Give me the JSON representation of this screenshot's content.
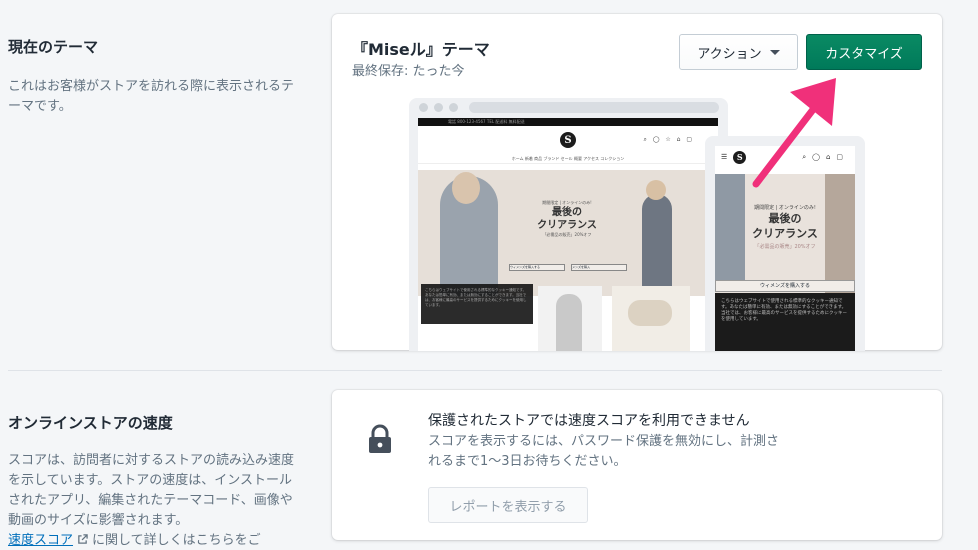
{
  "current_theme": {
    "heading": "現在のテーマ",
    "description": "これはお客様がストアを訪れる際に表示されるテーマです。",
    "theme_name": "『Miseル』テーマ",
    "saved_label": "最終保存: たった今",
    "action_button": "アクション",
    "customize_button": "カスタマイズ",
    "accent_color": "#007a5a",
    "arrow_color": "#f0307a"
  },
  "preview": {
    "topbar_text": "電話 800-123-4567 TEL   配送料 無料配送",
    "logo_letter": "S",
    "nav_text": "ホーム 新着  商品  ブランド  セール  概要  アクセス  コレクション",
    "hero_small": "期間限定 | オンラインのみ!",
    "hero_line1": "最後の",
    "hero_line2": "クリアランス",
    "hero_sub": "「必需品の販売」20%オフ",
    "hero_btn_women": "ウィメンズを購入する",
    "hero_btn_men": "メンズを購入",
    "cookie_text": "こちらはウェブサイトで使用される標準的なクッキー通知です。あなたは簡単に有効、または無効にすることができます。当社では、お客様に最高のサービスを提供するためにクッキーを使用しています。",
    "mobile_hero_small": "期間限定 | オンラインのみ!",
    "mobile_hero_line1": "最後の",
    "mobile_hero_line2": "クリアランス",
    "mobile_hero_sub": "「必需品の販売」20%オフ",
    "mobile_btn": "ウィメンズを購入する"
  },
  "speed": {
    "heading": "オンラインストアの速度",
    "description": "スコアは、訪問者に対するストアの読み込み速度を示しています。ストアの速度は、インストールされたアプリ、編集されたテーマコード、画像や動画のサイズに影響されます。",
    "link_text": "速度スコア",
    "after_link": "に関して詳しくはこちらをご",
    "card_title": "保護されたストアでは速度スコアを利用できません",
    "card_desc": "スコアを表示するには、パスワード保護を無効にし、計測されるまで1〜3日お待ちください。",
    "report_button": "レポートを表示する"
  }
}
